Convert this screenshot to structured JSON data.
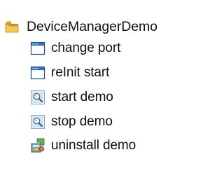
{
  "tree": {
    "root": {
      "label": "DeviceManagerDemo",
      "icon": "folder-icon",
      "icon_color": "#E8B84A"
    },
    "items": [
      {
        "label": "change port",
        "icon": "window-icon"
      },
      {
        "label": "reInit start",
        "icon": "window-icon"
      },
      {
        "label": "start demo",
        "icon": "magnifier-icon"
      },
      {
        "label": "stop demo",
        "icon": "magnifier-icon"
      },
      {
        "label": "uninstall demo",
        "icon": "installer-icon"
      }
    ]
  },
  "colors": {
    "text": "#111111",
    "window_titlebar": "#2B6CC4",
    "window_body": "#FFFFFF"
  }
}
